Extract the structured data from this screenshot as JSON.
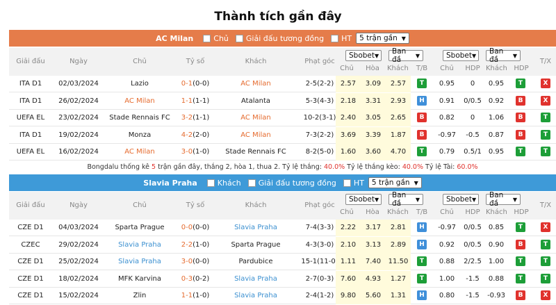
{
  "page_title": "Thành tích gần đây",
  "columns": {
    "league": "Giải đấu",
    "date": "Ngày",
    "home": "Chủ",
    "score": "Tỷ số",
    "away": "Khách",
    "corner": "Phạt góc",
    "odds_1x2_select": "Sbobet",
    "odds_1x2_sub": [
      "Chủ",
      "Hòa",
      "Khách"
    ],
    "tb": "T/B",
    "ah_over_select": "Sbobet",
    "ah_over_sub": [
      "Chủ",
      "HDP",
      "Khách",
      "HDP"
    ],
    "ban_select": "Ban đầ",
    "tx": "T/X"
  },
  "milan": {
    "team": "AC Milan",
    "opt_home": "Chủ",
    "opt_same_league": "Giải đấu tương đồng",
    "opt_ht": "HT",
    "range": "5 trận gần",
    "rows": [
      {
        "league": "ITA D1",
        "date": "02/03/2024",
        "home": "Lazio",
        "score": "0-1",
        "ht": "(0-0)",
        "away": "AC Milan",
        "corner": "2-5(2-2)",
        "o1": "2.57",
        "ox": "3.09",
        "o2": "2.57",
        "tb": "T",
        "a1": "0.95",
        "hdp": "0",
        "a2": "0.95",
        "hdp2": "T",
        "tx": "X"
      },
      {
        "league": "ITA D1",
        "date": "26/02/2024",
        "home": "AC Milan",
        "score": "1-1",
        "ht": "(1-1)",
        "away": "Atalanta",
        "corner": "5-3(4-3)",
        "o1": "2.18",
        "ox": "3.31",
        "o2": "2.93",
        "tb": "H",
        "a1": "0.91",
        "hdp": "0/0.5",
        "a2": "0.92",
        "hdp2": "B",
        "tx": "X"
      },
      {
        "league": "UEFA EL",
        "date": "23/02/2024",
        "home": "Stade Rennais FC",
        "score": "3-2",
        "ht": "(1-1)",
        "away": "AC Milan",
        "corner": "10-2(3-1)",
        "o1": "2.40",
        "ox": "3.05",
        "o2": "2.65",
        "tb": "B",
        "a1": "0.82",
        "hdp": "0",
        "a2": "1.06",
        "hdp2": "B",
        "tx": "T"
      },
      {
        "league": "ITA D1",
        "date": "19/02/2024",
        "home": "Monza",
        "score": "4-2",
        "ht": "(2-0)",
        "away": "AC Milan",
        "corner": "7-3(2-2)",
        "o1": "3.69",
        "ox": "3.39",
        "o2": "1.87",
        "tb": "B",
        "a1": "-0.97",
        "hdp": "-0.5",
        "a2": "0.87",
        "hdp2": "B",
        "tx": "T"
      },
      {
        "league": "UEFA EL",
        "date": "16/02/2024",
        "home": "AC Milan",
        "score": "3-0",
        "ht": "(1-0)",
        "away": "Stade Rennais FC",
        "corner": "8-2(5-0)",
        "o1": "1.60",
        "ox": "3.60",
        "o2": "4.70",
        "tb": "T",
        "a1": "0.79",
        "hdp": "0.5/1",
        "a2": "0.95",
        "hdp2": "T",
        "tx": "T"
      }
    ],
    "summary": {
      "a": "Bongdalu thống kê ",
      "n": "5",
      "b": " trận gần đây, thắng 2, hòa 1, thua 2. Tỷ lệ thắng: ",
      "win": "40.0%",
      "c": " Tỷ lệ thắng kèo: ",
      "ah": "40.0%",
      "d": " Tỷ lệ Tài: ",
      "over": "60.0%"
    }
  },
  "slavia": {
    "team": "Slavia Praha",
    "opt_away": "Khách",
    "opt_same_league": "Giải đấu tương đồng",
    "opt_ht": "HT",
    "range": "5 trận gần",
    "rows": [
      {
        "league": "CZE D1",
        "date": "04/03/2024",
        "home": "Sparta Prague",
        "score": "0-0",
        "ht": "(0-0)",
        "away": "Slavia Praha",
        "corner": "7-4(3-3)",
        "o1": "2.22",
        "ox": "3.17",
        "o2": "2.81",
        "tb": "H",
        "a1": "-0.97",
        "hdp": "0/0.5",
        "a2": "0.85",
        "hdp2": "T",
        "tx": "X"
      },
      {
        "league": "CZEC",
        "date": "29/02/2024",
        "home": "Slavia Praha",
        "score": "2-2",
        "ht": "(1-0)",
        "away": "Sparta Prague",
        "corner": "4-3(3-0)",
        "o1": "2.10",
        "ox": "3.13",
        "o2": "2.89",
        "tb": "H",
        "a1": "0.92",
        "hdp": "0/0.5",
        "a2": "0.90",
        "hdp2": "B",
        "tx": "T"
      },
      {
        "league": "CZE D1",
        "date": "25/02/2024",
        "home": "Slavia Praha",
        "score": "3-0",
        "ht": "(0-0)",
        "away": "Pardubice",
        "corner": "15-1(11-0)",
        "o1": "1.11",
        "ox": "7.40",
        "o2": "11.50",
        "tb": "T",
        "a1": "0.88",
        "hdp": "2/2.5",
        "a2": "1.00",
        "hdp2": "T",
        "tx": "T"
      },
      {
        "league": "CZE D1",
        "date": "18/02/2024",
        "home": "MFK Karvina",
        "score": "0-3",
        "ht": "(0-2)",
        "away": "Slavia Praha",
        "corner": "2-7(0-3)",
        "o1": "7.60",
        "ox": "4.93",
        "o2": "1.27",
        "tb": "T",
        "a1": "1.00",
        "hdp": "-1.5",
        "a2": "0.88",
        "hdp2": "T",
        "tx": "T"
      },
      {
        "league": "CZE D1",
        "date": "15/02/2024",
        "home": "Zlin",
        "score": "1-1",
        "ht": "(1-0)",
        "away": "Slavia Praha",
        "corner": "2-4(1-2)",
        "o1": "9.80",
        "ox": "5.60",
        "o2": "1.31",
        "tb": "H",
        "a1": "0.80",
        "hdp": "-1.5",
        "a2": "-0.93",
        "hdp2": "B",
        "tx": "X"
      }
    ]
  }
}
